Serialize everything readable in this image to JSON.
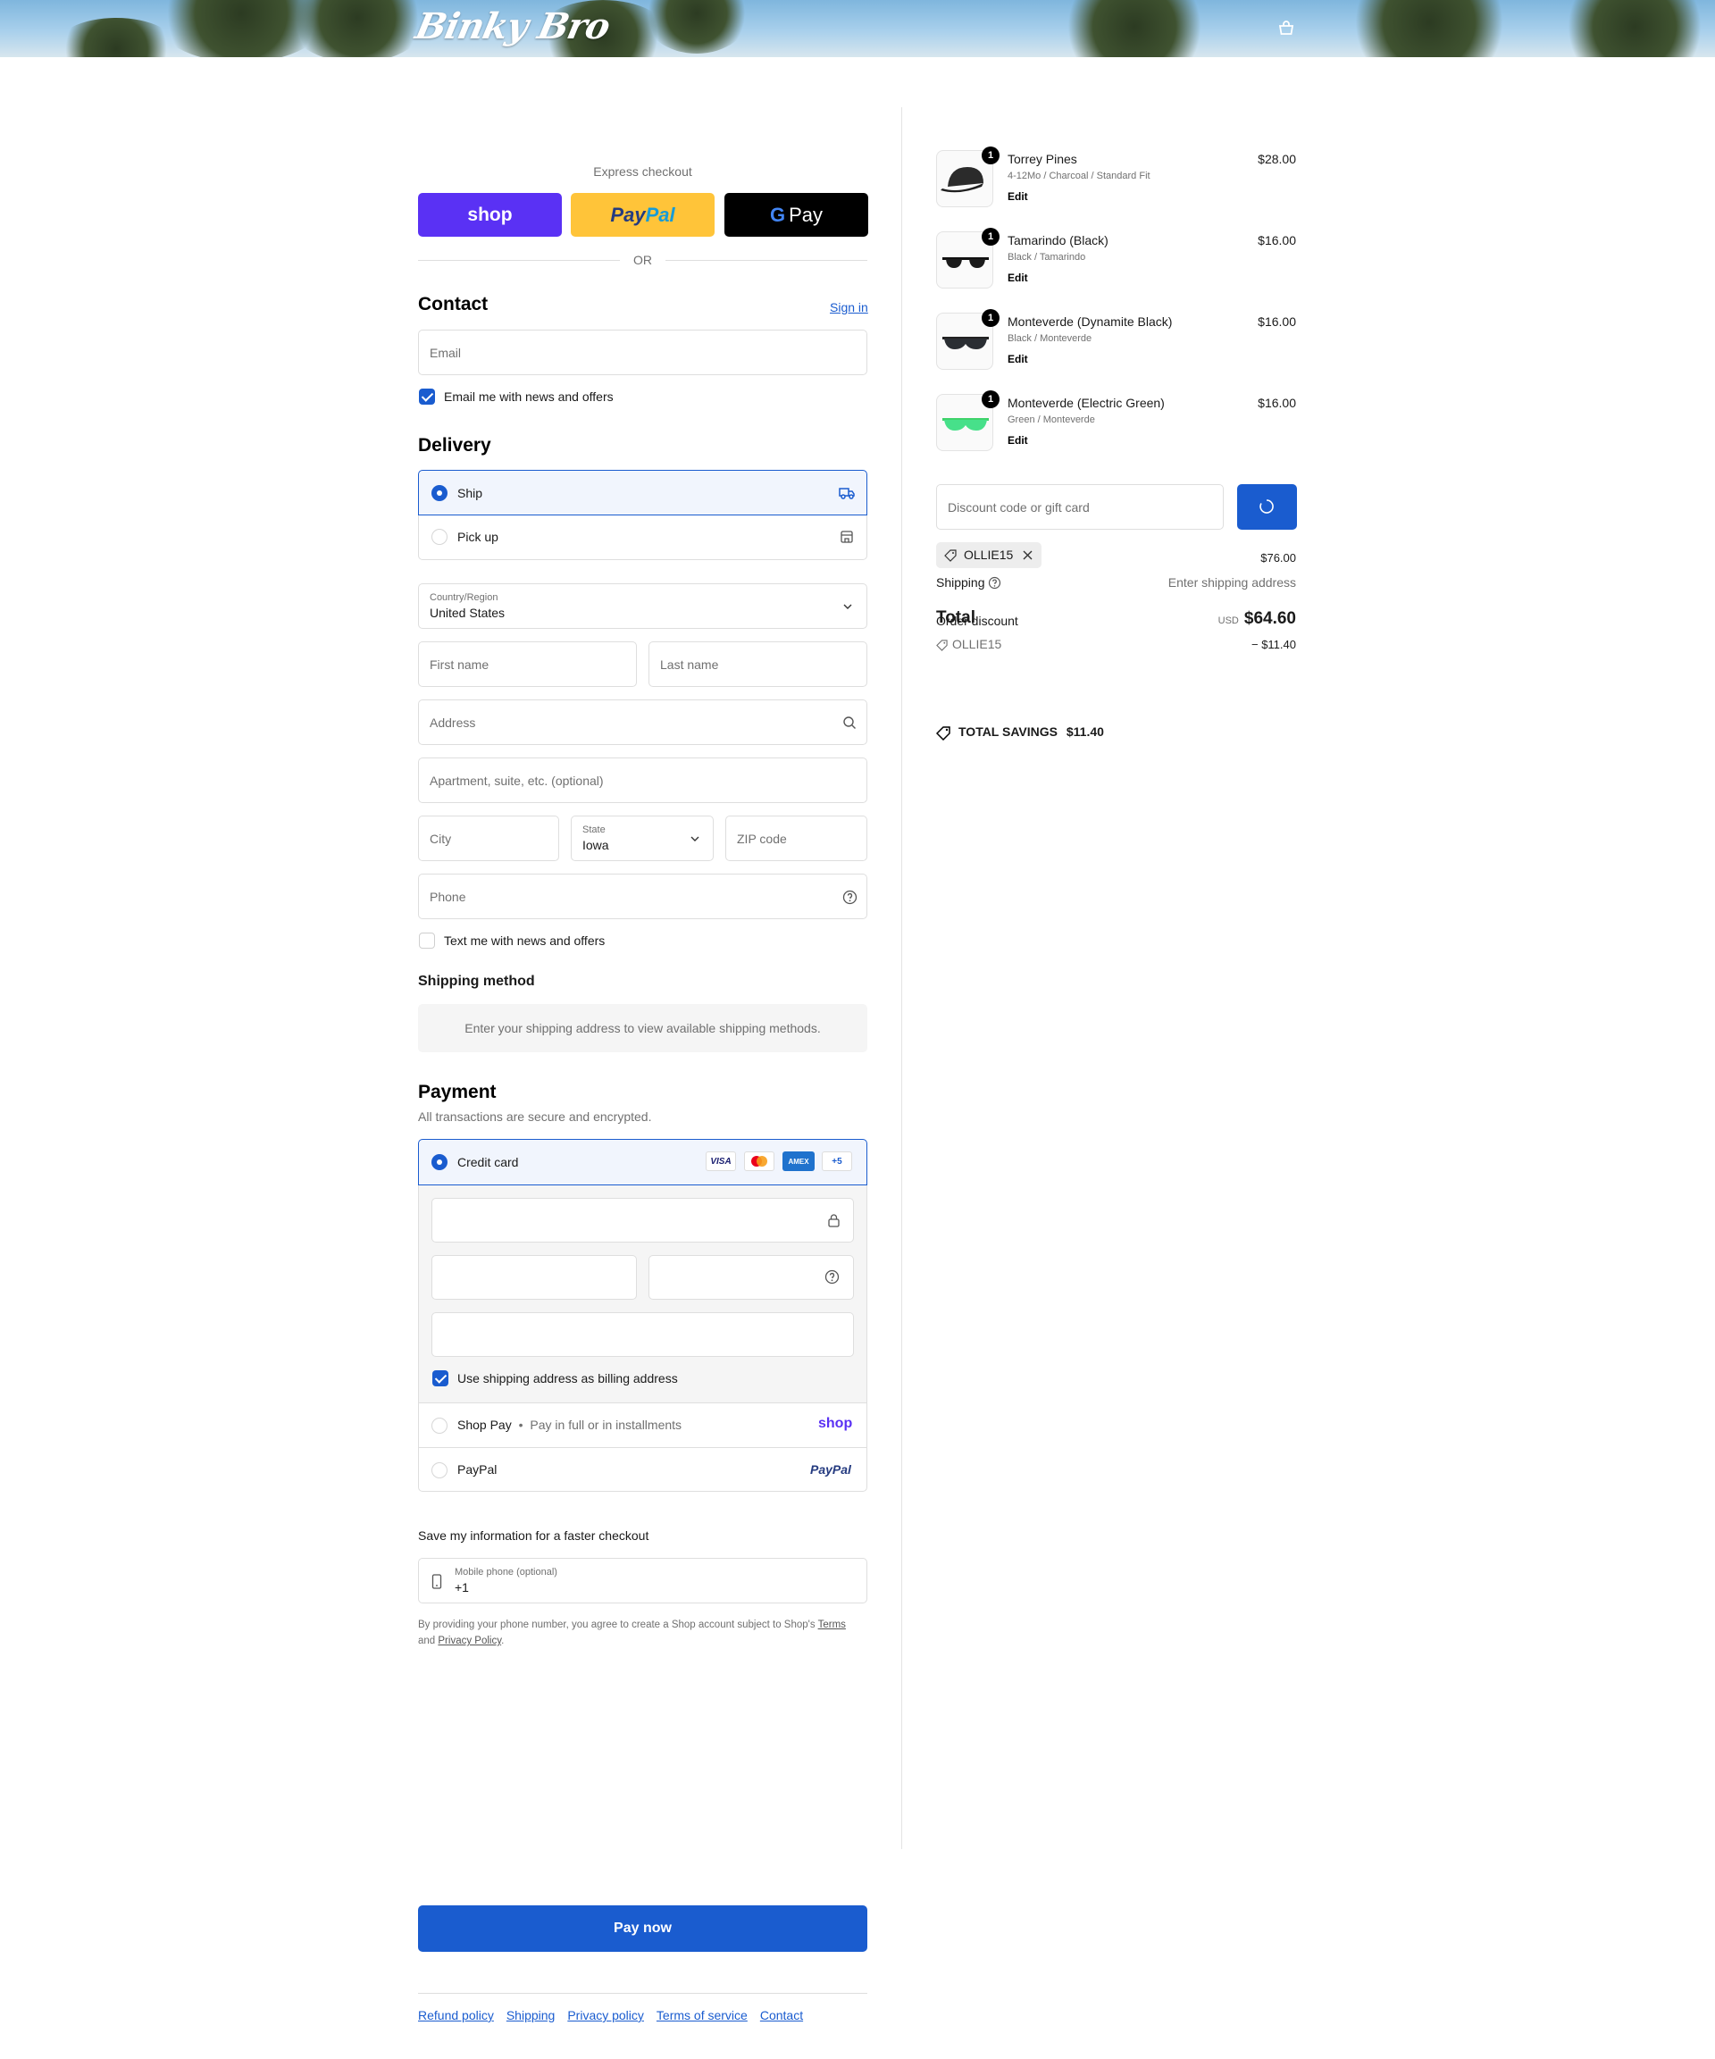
{
  "header": {
    "logo": "Binky Bro"
  },
  "express": {
    "title": "Express checkout",
    "shop_label": "shop",
    "paypal_label_a": "Pay",
    "paypal_label_b": "Pal",
    "gpay_g": "G",
    "gpay_label": "Pay",
    "or": "OR"
  },
  "contact": {
    "title": "Contact",
    "sign_in": "Sign in",
    "email_placeholder": "Email",
    "news_label": "Email me with news and offers"
  },
  "delivery": {
    "title": "Delivery",
    "ship_label": "Ship",
    "pickup_label": "Pick up",
    "country_label": "Country/Region",
    "country_value": "United States",
    "first_name": "First name",
    "last_name": "Last name",
    "address": "Address",
    "apartment": "Apartment, suite, etc. (optional)",
    "city": "City",
    "state_label": "State",
    "state_value": "Iowa",
    "zip": "ZIP code",
    "phone": "Phone",
    "text_label": "Text me with news and offers"
  },
  "shipping_method": {
    "title": "Shipping method",
    "notice": "Enter your shipping address to view available shipping methods."
  },
  "payment": {
    "title": "Payment",
    "subtitle": "All transactions are secure and encrypted.",
    "credit_card": "Credit card",
    "visa": "VISA",
    "amex": "AMEX",
    "more": "+5",
    "billing_label": "Use shipping address as billing address",
    "shoppay_label": "Shop Pay",
    "shoppay_sub": "Pay in full or in installments",
    "shoppay_logo": "shop",
    "paypal_label": "PayPal",
    "paypal_logo": "PayPal"
  },
  "save_info": {
    "title": "Save my information for a faster checkout",
    "mobile_label": "Mobile phone (optional)",
    "mobile_value": "+1",
    "legal_a": "By providing your phone number, you agree to create a Shop account subject to Shop's",
    "terms": "Terms",
    "legal_and": "and",
    "privacy": "Privacy Policy",
    "legal_end": "."
  },
  "pay_now": "Pay now",
  "footer_links": [
    "Refund policy",
    "Shipping",
    "Privacy policy",
    "Terms of service",
    "Contact"
  ],
  "cart": {
    "items": [
      {
        "qty": "1",
        "title": "Torrey Pines",
        "variant": "4-12Mo / Charcoal / Standard Fit",
        "edit": "Edit",
        "price": "$28.00"
      },
      {
        "qty": "1",
        "title": "Tamarindo (Black)",
        "variant": "Black / Tamarindo",
        "edit": "Edit",
        "price": "$16.00"
      },
      {
        "qty": "1",
        "title": "Monteverde (Dynamite Black)",
        "variant": "Black / Monteverde",
        "edit": "Edit",
        "price": "$16.00"
      },
      {
        "qty": "1",
        "title": "Monteverde (Electric Green)",
        "variant": "Green / Monteverde",
        "edit": "Edit",
        "price": "$16.00"
      }
    ],
    "discount_placeholder": "Discount code or gift card",
    "applied_code": "OLLIE15",
    "subtotal_value": "$76.00",
    "shipping_label": "Shipping",
    "shipping_value": "Enter shipping address",
    "total_label": "Total",
    "order_discount": "Order discount",
    "discount_code": "OLLIE15",
    "discount_value": "− $11.40",
    "currency": "USD",
    "total_value": "$64.60",
    "total_savings_label": "TOTAL SAVINGS",
    "total_savings_value": "$11.40"
  },
  "colors": {
    "accent": "#1a5ccf",
    "shop_purple": "#5a31f4",
    "paypal_yellow": "#ffc439"
  }
}
